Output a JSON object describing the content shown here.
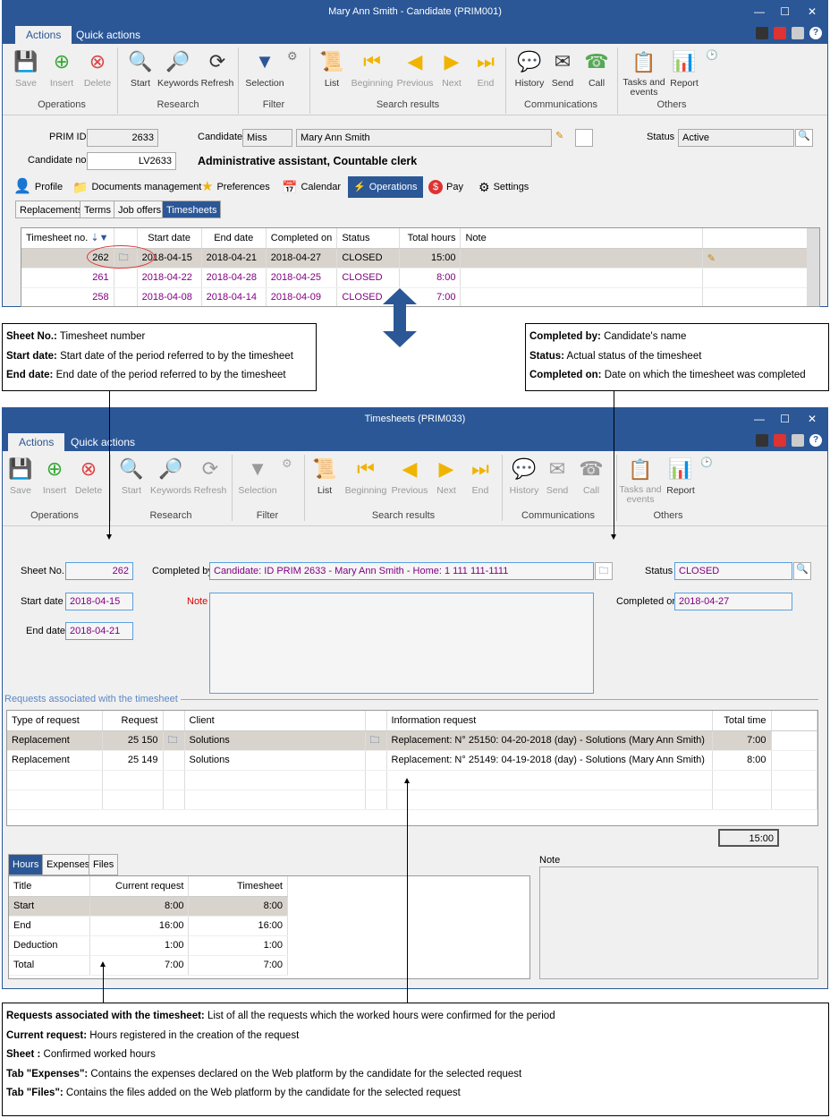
{
  "top": {
    "title": "Mary Ann Smith - Candidate (PRIM001)",
    "tab_actions": "Actions",
    "tab_quick": "Quick actions",
    "ribbon": {
      "save": "Save",
      "insert": "Insert",
      "delete": "Delete",
      "start": "Start",
      "keywords": "Keywords",
      "refresh": "Refresh",
      "selection": "Selection",
      "list": "List",
      "beginning": "Beginning",
      "previous": "Previous",
      "next": "Next",
      "end": "End",
      "history": "History",
      "send": "Send",
      "call": "Call",
      "tasks": "Tasks and events",
      "report": "Report",
      "g_operations": "Operations",
      "g_research": "Research",
      "g_filter": "Filter",
      "g_search": "Search results",
      "g_comm": "Communications",
      "g_others": "Others"
    },
    "prim_id_label": "PRIM ID",
    "prim_id": "2633",
    "candidate_label": "Candidate",
    "title_val": "Miss",
    "name_val": "Mary Ann Smith",
    "status_label": "Status",
    "status_val": "Active",
    "cand_no_label": "Candidate no.",
    "cand_no": "LV2633",
    "position": "Administrative assistant, Countable clerk",
    "main_tabs": [
      "Profile",
      "Documents management",
      "Preferences",
      "Calendar",
      "Operations",
      "Pay",
      "Settings"
    ],
    "sub_tabs": [
      "Replacements",
      "Terms",
      "Job offers",
      "Timesheets"
    ],
    "ts_headers": [
      "Timesheet no.",
      "",
      "Start date",
      "End date",
      "Completed on",
      "Status",
      "Total hours",
      "Note"
    ],
    "ts_rows": [
      [
        "262",
        "2018-04-15",
        "2018-04-21",
        "2018-04-27",
        "CLOSED",
        "15:00"
      ],
      [
        "261",
        "2018-04-22",
        "2018-04-28",
        "2018-04-25",
        "CLOSED",
        "8:00"
      ],
      [
        "258",
        "2018-04-08",
        "2018-04-14",
        "2018-04-09",
        "CLOSED",
        "7:00"
      ]
    ]
  },
  "note_left": [
    [
      "Sheet No.:",
      " Timesheet number"
    ],
    [
      "Start date:",
      " Start date of the period referred to by the timesheet"
    ],
    [
      "End date:",
      " End date of the period referred to by the timesheet"
    ]
  ],
  "note_right": [
    [
      "Completed by:",
      " Candidate's name"
    ],
    [
      "Status:",
      " Actual status of the timesheet"
    ],
    [
      "Completed on:",
      " Date on which the timesheet was completed"
    ]
  ],
  "bottom": {
    "title": "Timesheets (PRIM033)",
    "sheet_no_label": "Sheet No.",
    "sheet_no": "262",
    "completed_by_label": "Completed by",
    "completed_by": "Candidate: ID PRIM 2633 - Mary Ann Smith - Home: 1 111 111-1111",
    "status_label": "Status",
    "status_val": "CLOSED",
    "start_label": "Start date",
    "start_val": "2018-04-15",
    "note_label": "Note",
    "completed_on_label": "Completed on",
    "completed_on": "2018-04-27",
    "end_label": "End date",
    "end_val": "2018-04-21",
    "req_section": "Requests associated with the timesheet",
    "req_headers": [
      "Type of request",
      "Request",
      "",
      "Client",
      "",
      "Information request",
      "Total time"
    ],
    "req_rows": [
      [
        "Replacement",
        "25 150",
        "Solutions",
        "Replacement: N° 25150: 04-20-2018 (day) - Solutions (Mary Ann Smith)",
        "7:00"
      ],
      [
        "Replacement",
        "25 149",
        "Solutions",
        "Replacement: N° 25149: 04-19-2018 (day) - Solutions (Mary Ann Smith)",
        "8:00"
      ]
    ],
    "total": "15:00",
    "htabs": [
      "Hours",
      "Expenses",
      "Files"
    ],
    "hours_headers": [
      "Title",
      "Current request",
      "Timesheet"
    ],
    "hours_rows": [
      [
        "Start",
        "8:00",
        "8:00"
      ],
      [
        "End",
        "16:00",
        "16:00"
      ],
      [
        "Deduction",
        "1:00",
        "1:00"
      ],
      [
        "Total",
        "7:00",
        "7:00"
      ]
    ],
    "note2_label": "Note"
  },
  "note_bottom": [
    [
      "Requests associated with the timesheet:",
      " List of all the requests which the worked hours were confirmed for the period"
    ],
    [
      "Current request:",
      " Hours registered in the creation of the request"
    ],
    [
      "Sheet :",
      " Confirmed worked hours"
    ],
    [
      "Tab \"Expenses\":",
      " Contains the expenses declared on the Web platform by the candidate for the selected request"
    ],
    [
      "Tab \"Files\":",
      " Contains the files added on the Web platform by the candidate for the selected request"
    ]
  ]
}
